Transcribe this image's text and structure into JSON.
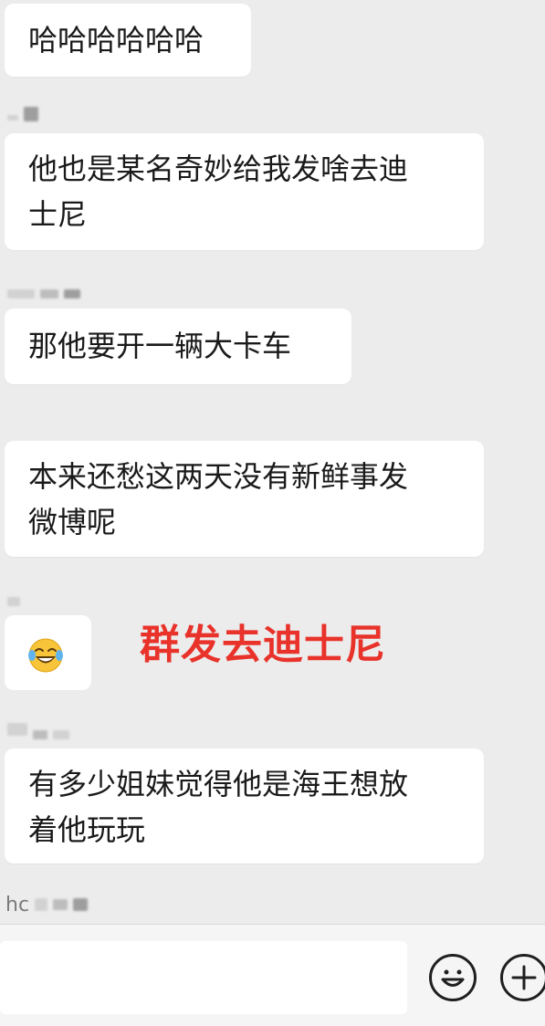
{
  "messages": [
    {
      "text": "哈哈哈哈哈哈"
    },
    {
      "text_line1": "他也是某名奇妙给我发啥去迪",
      "text_line2": "士尼"
    },
    {
      "text": "那他要开一辆大卡车"
    },
    {
      "text_line1": "本来还愁这两天没有新鲜事发",
      "text_line2": "微博呢"
    },
    {
      "emoji": "laughing-crying-emoji"
    },
    {
      "text_line1": "有多少姐妹觉得他是海王想放",
      "text_line2": "着他玩玩"
    }
  ],
  "overlay_caption": "群发去迪士尼",
  "senders": {
    "last_visible_prefix": "hc"
  },
  "input_bar": {
    "emoji_button_icon": "smiley-face-icon",
    "more_button_icon": "plus-circle-icon"
  },
  "colors": {
    "chat_background": "#ececec",
    "bubble": "#ffffff",
    "caption_red": "#e8322a"
  }
}
